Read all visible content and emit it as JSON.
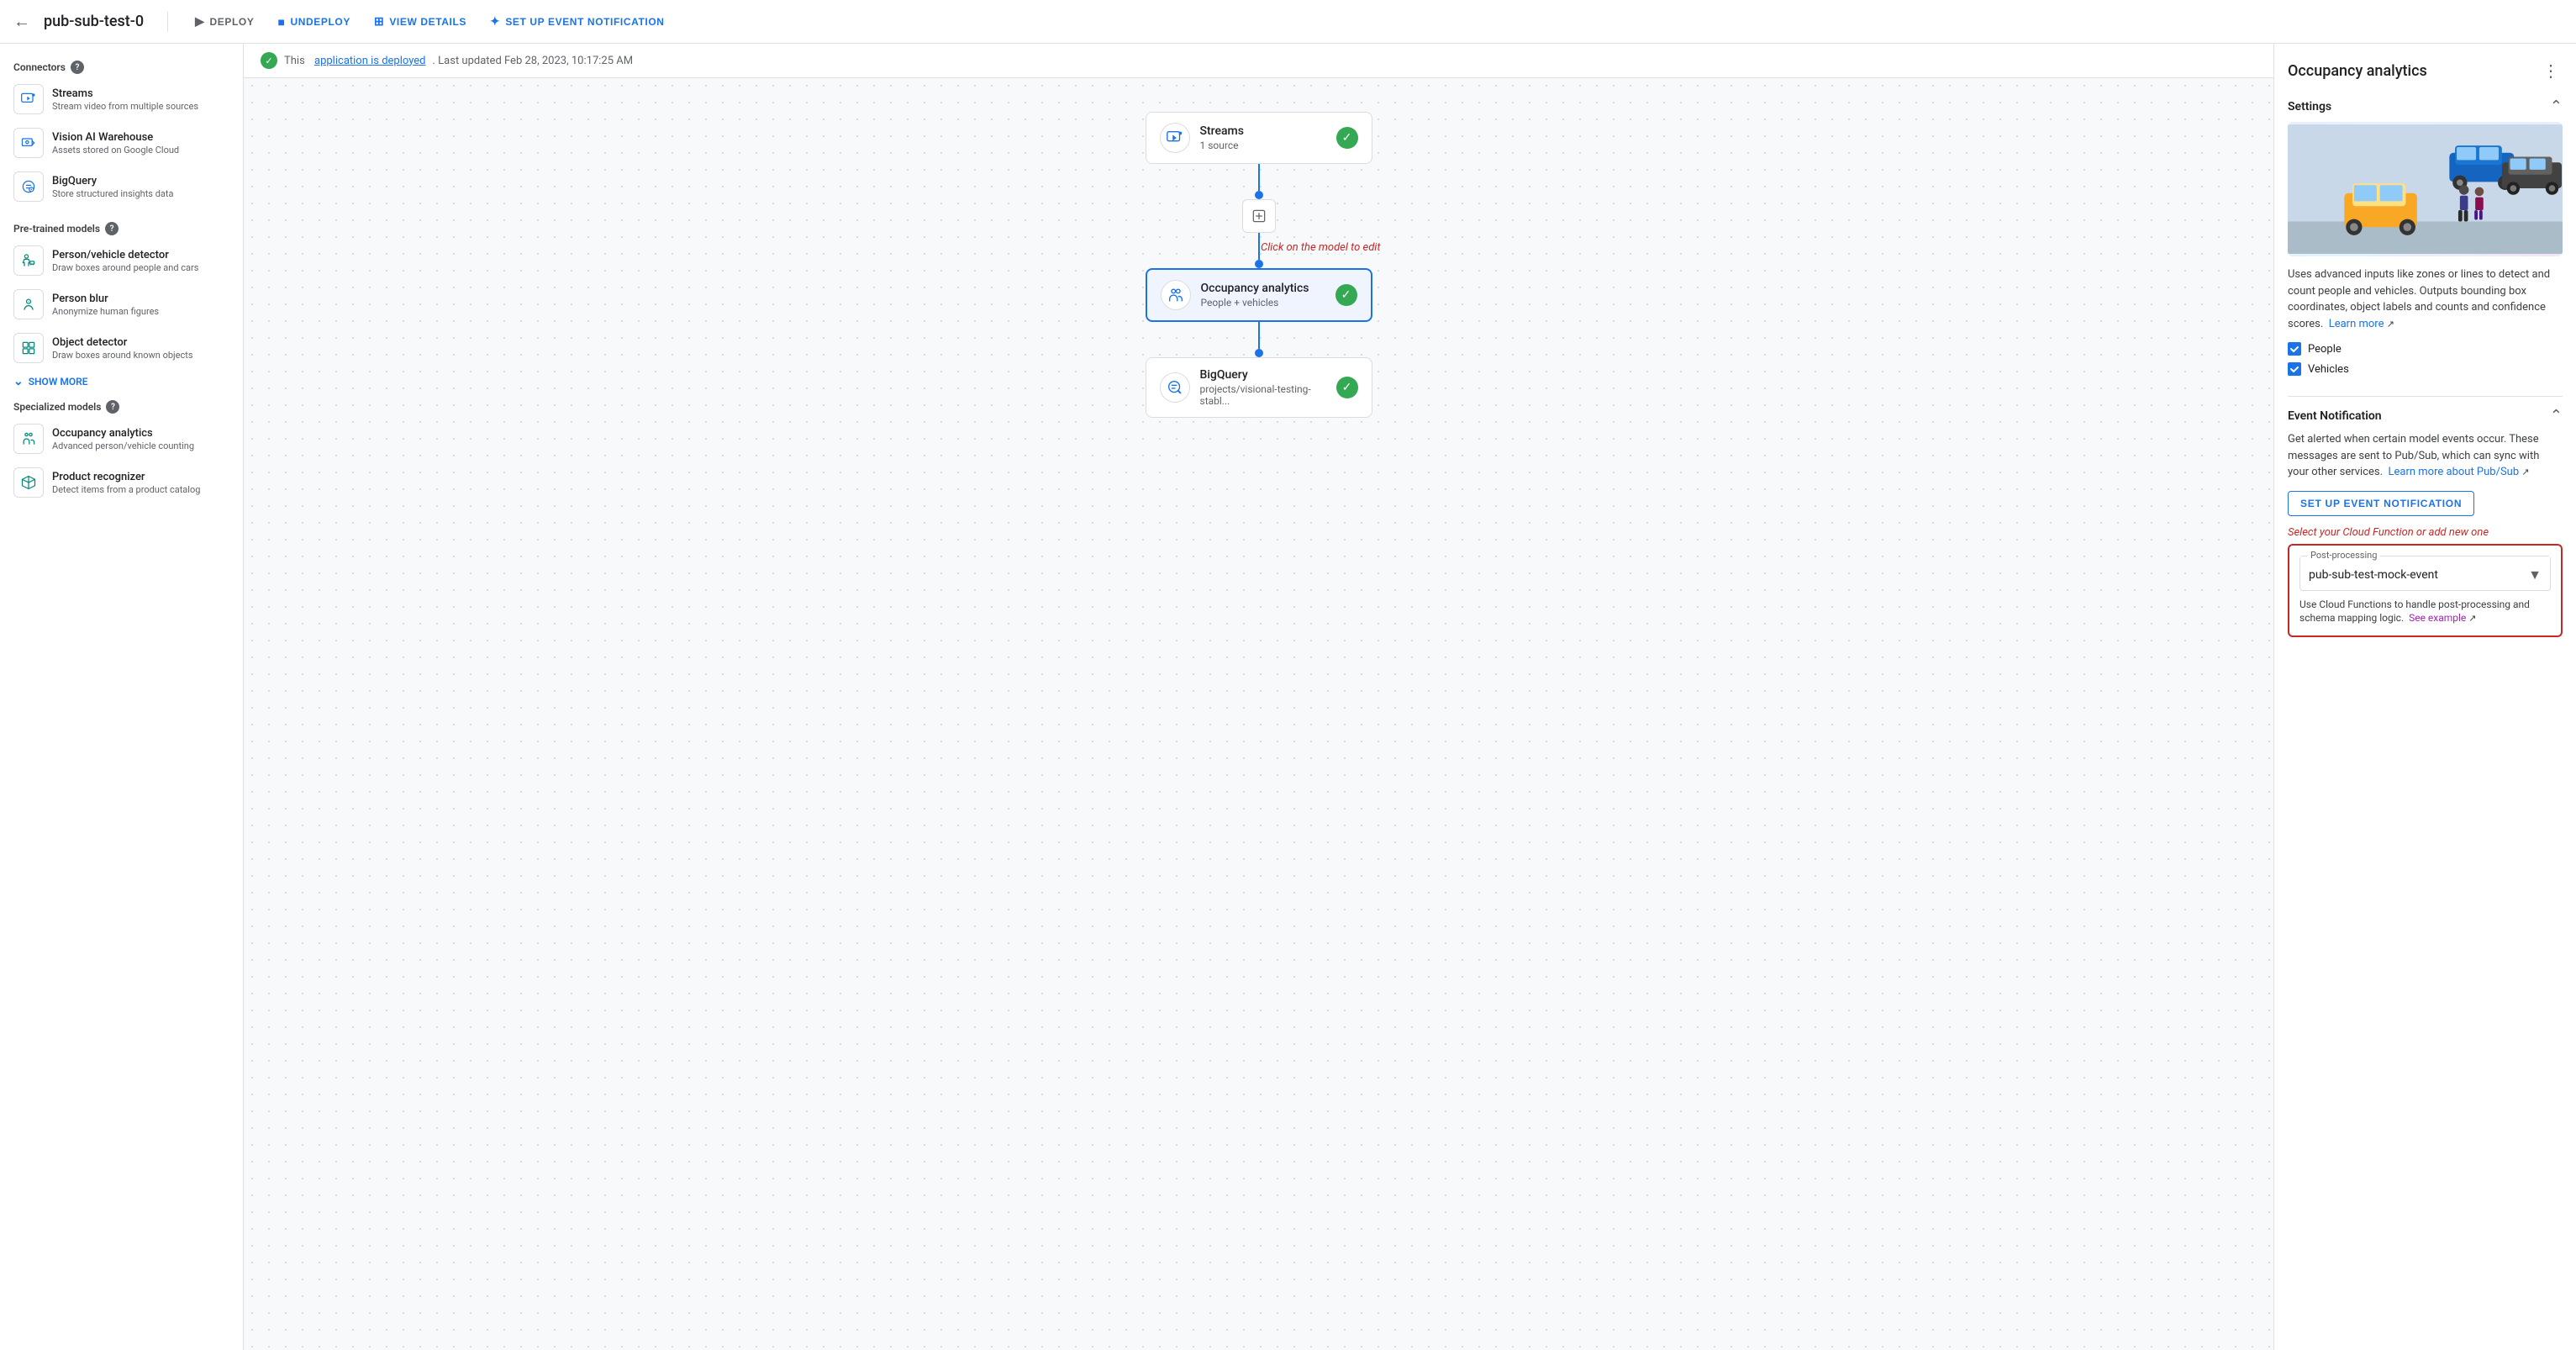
{
  "topbar": {
    "back_icon": "←",
    "title": "pub-sub-test-0",
    "deploy_label": "DEPLOY",
    "undeploy_label": "UNDEPLOY",
    "viewdetails_label": "VIEW DETAILS",
    "setup_label": "SET UP EVENT NOTIFICATION"
  },
  "status": {
    "text_prefix": "This",
    "link_text": "application is deployed",
    "text_suffix": ". Last updated Feb 28, 2023, 10:17:25 AM"
  },
  "sidebar": {
    "connectors_title": "Connectors",
    "connectors": [
      {
        "name": "Streams",
        "desc": "Stream video from multiple sources",
        "icon": "streams"
      },
      {
        "name": "Vision AI Warehouse",
        "desc": "Assets stored on Google Cloud",
        "icon": "vision"
      },
      {
        "name": "BigQuery",
        "desc": "Store structured insights data",
        "icon": "bigquery"
      }
    ],
    "pretrained_title": "Pre-trained models",
    "pretrained": [
      {
        "name": "Person/vehicle detector",
        "desc": "Draw boxes around people and cars",
        "icon": "person"
      },
      {
        "name": "Person blur",
        "desc": "Anonymize human figures",
        "icon": "blur"
      },
      {
        "name": "Object detector",
        "desc": "Draw boxes around known objects",
        "icon": "object"
      }
    ],
    "show_more": "SHOW MORE",
    "specialized_title": "Specialized models",
    "specialized": [
      {
        "name": "Occupancy analytics",
        "desc": "Advanced person/vehicle counting",
        "icon": "occupancy"
      },
      {
        "name": "Product recognizer",
        "desc": "Detect items from a product catalog",
        "icon": "product"
      }
    ]
  },
  "canvas": {
    "tooltip": "Click on the model to edit",
    "nodes": [
      {
        "id": "streams",
        "title": "Streams",
        "subtitle": "1 source",
        "type": "connector"
      },
      {
        "id": "occupancy",
        "title": "Occupancy analytics",
        "subtitle": "People + vehicles",
        "type": "model",
        "selected": true
      },
      {
        "id": "bigquery",
        "title": "BigQuery",
        "subtitle": "projects/visional-testing-stabl...",
        "type": "connector"
      }
    ]
  },
  "right_panel": {
    "title": "Occupancy analytics",
    "settings_title": "Settings",
    "description": "Uses advanced inputs like zones or lines to detect and count people and vehicles. Outputs bounding box coordinates, object labels and counts and confidence scores.",
    "learn_more": "Learn more",
    "checkboxes": [
      {
        "label": "People",
        "checked": true
      },
      {
        "label": "Vehicles",
        "checked": true
      }
    ],
    "event_notif_title": "Event Notification",
    "event_notif_desc": "Get alerted when certain model events occur. These messages are sent to Pub/Sub, which can sync with your other services.",
    "learn_more_pubsub": "Learn more about Pub/Sub",
    "setup_btn": "SET UP EVENT NOTIFICATION",
    "cloud_fn_hint": "Select your Cloud Function or add new one",
    "post_processing_label": "Post-processing",
    "post_processing_value": "pub-sub-test-mock-event",
    "post_proc_desc": "Use Cloud Functions to handle post-processing and schema mapping logic.",
    "see_example": "See example"
  }
}
